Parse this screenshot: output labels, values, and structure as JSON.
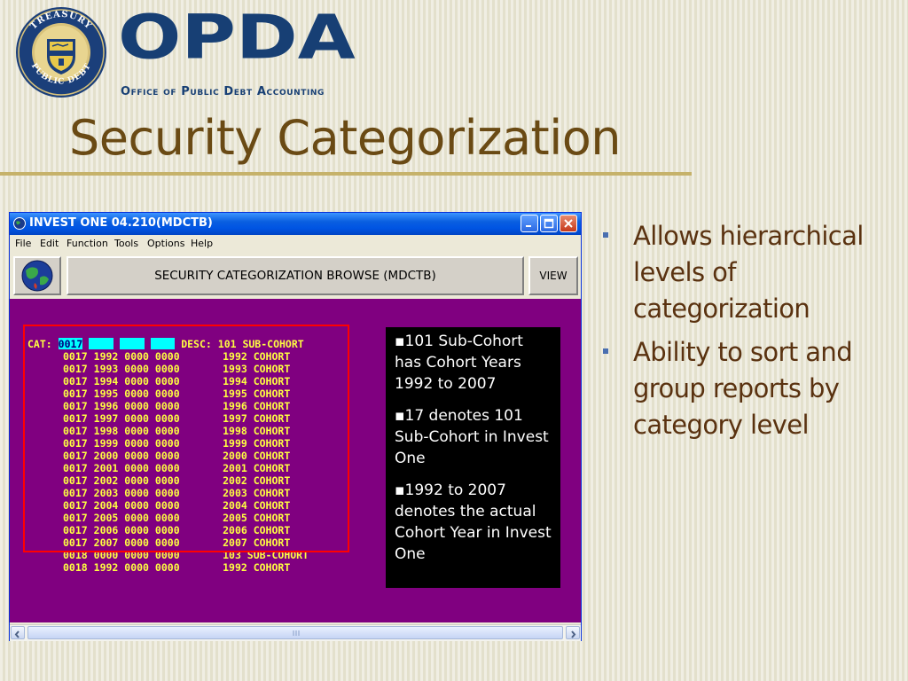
{
  "header": {
    "seal_top_text": "TREASURY",
    "seal_bottom_text": "PUBLIC DEBT",
    "logo_text": "OPDA",
    "logo_subtitle": "Office of Public Debt Accounting",
    "slide_title": "Security Categorization"
  },
  "window": {
    "title": "INVEST ONE 04.210(MDCTB)",
    "menu": [
      "File",
      "Edit",
      "Function",
      "Tools",
      "Options",
      "Help"
    ],
    "screen_title": "SECURITY CATEGORIZATION BROWSE (MDCTB)",
    "view_label": "VIEW",
    "cat_label": "CAT:",
    "cat_value": "0017",
    "desc_label": "DESC:",
    "desc_value": "101 SUB-COHORT",
    "rows": [
      {
        "code": "0017",
        "year": "1992",
        "f3": "0000",
        "f4": "0000",
        "desc": "1992 COHORT"
      },
      {
        "code": "0017",
        "year": "1993",
        "f3": "0000",
        "f4": "0000",
        "desc": "1993 COHORT"
      },
      {
        "code": "0017",
        "year": "1994",
        "f3": "0000",
        "f4": "0000",
        "desc": "1994 COHORT"
      },
      {
        "code": "0017",
        "year": "1995",
        "f3": "0000",
        "f4": "0000",
        "desc": "1995 COHORT"
      },
      {
        "code": "0017",
        "year": "1996",
        "f3": "0000",
        "f4": "0000",
        "desc": "1996 COHORT"
      },
      {
        "code": "0017",
        "year": "1997",
        "f3": "0000",
        "f4": "0000",
        "desc": "1997 COHORT"
      },
      {
        "code": "0017",
        "year": "1998",
        "f3": "0000",
        "f4": "0000",
        "desc": "1998 COHORT"
      },
      {
        "code": "0017",
        "year": "1999",
        "f3": "0000",
        "f4": "0000",
        "desc": "1999 COHORT"
      },
      {
        "code": "0017",
        "year": "2000",
        "f3": "0000",
        "f4": "0000",
        "desc": "2000 COHORT"
      },
      {
        "code": "0017",
        "year": "2001",
        "f3": "0000",
        "f4": "0000",
        "desc": "2001 COHORT"
      },
      {
        "code": "0017",
        "year": "2002",
        "f3": "0000",
        "f4": "0000",
        "desc": "2002 COHORT"
      },
      {
        "code": "0017",
        "year": "2003",
        "f3": "0000",
        "f4": "0000",
        "desc": "2003 COHORT"
      },
      {
        "code": "0017",
        "year": "2004",
        "f3": "0000",
        "f4": "0000",
        "desc": "2004 COHORT"
      },
      {
        "code": "0017",
        "year": "2005",
        "f3": "0000",
        "f4": "0000",
        "desc": "2005 COHORT"
      },
      {
        "code": "0017",
        "year": "2006",
        "f3": "0000",
        "f4": "0000",
        "desc": "2006 COHORT"
      },
      {
        "code": "0017",
        "year": "2007",
        "f3": "0000",
        "f4": "0000",
        "desc": "2007 COHORT"
      },
      {
        "code": "0018",
        "year": "0000",
        "f3": "0000",
        "f4": "0000",
        "desc": "103 SUB-COHORT"
      },
      {
        "code": "0018",
        "year": "1992",
        "f3": "0000",
        "f4": "0000",
        "desc": "1992 COHORT"
      }
    ],
    "notes": [
      "▪101 Sub-Cohort has Cohort Years 1992 to 2007",
      "▪17 denotes 101 Sub-Cohort in Invest One",
      "▪1992 to 2007 denotes the actual Cohort Year in Invest One"
    ]
  },
  "bullets": [
    "Allows hierarchical levels of categorization",
    "Ability to sort and group reports by category level"
  ],
  "colors": {
    "background": "#e3e0cc",
    "logo_blue": "#173f74",
    "title_brown": "#6a4a14",
    "terminal_bg": "#800080",
    "terminal_text": "#ffff40",
    "field_cyan": "#00ffff",
    "highlight_red": "#ff0000",
    "bullet_text": "#5a3210"
  }
}
